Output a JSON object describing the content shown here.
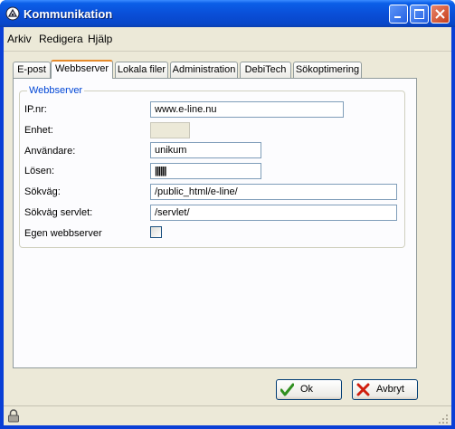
{
  "window": {
    "title": "Kommunikation"
  },
  "menu": [
    {
      "label": "Arkiv"
    },
    {
      "label": "Redigera"
    },
    {
      "label": "Hjälp"
    }
  ],
  "tabs": [
    {
      "label": "E-post",
      "active": false
    },
    {
      "label": "Webbserver",
      "active": true
    },
    {
      "label": "Lokala filer",
      "active": false
    },
    {
      "label": "Administration",
      "active": false
    },
    {
      "label": "DebiTech",
      "active": false
    },
    {
      "label": "Sökoptimering",
      "active": false
    }
  ],
  "webserver": {
    "group_label": "Webbserver",
    "ip": {
      "label": "IP.nr:",
      "value": "www.e-line.nu"
    },
    "unit": {
      "label": "Enhet:",
      "value": ""
    },
    "user": {
      "label": "Användare:",
      "value": "unikum"
    },
    "password": {
      "label": "Lösen:",
      "value": "||||||"
    },
    "path": {
      "label": "Sökväg:",
      "value": "/public_html/e-line/"
    },
    "servlet_path": {
      "label": "Sökväg servlet:",
      "value": "/servlet/"
    },
    "own_server": {
      "label": "Egen webbserver",
      "checked": false
    }
  },
  "buttons": {
    "ok": "Ok",
    "cancel": "Avbryt"
  },
  "colors": {
    "accent": "#0046d5",
    "tab_highlight": "#e68b2c",
    "titlebar": "#0a4fd8"
  }
}
